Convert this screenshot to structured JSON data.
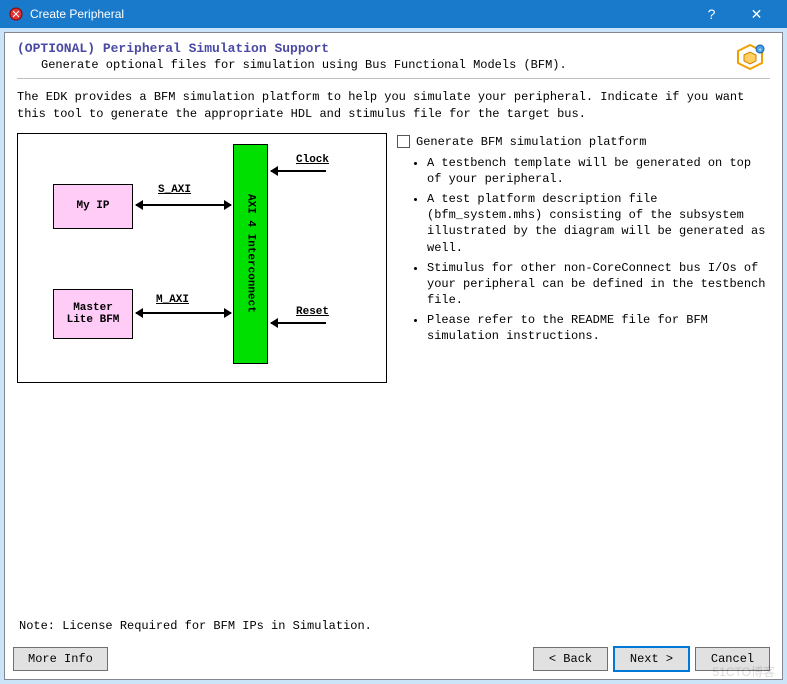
{
  "window": {
    "title": "Create Peripheral",
    "help_icon": "?",
    "close_icon": "✕"
  },
  "header": {
    "title": "(OPTIONAL) Peripheral Simulation Support",
    "description": "Generate optional files for simulation using Bus Functional Models (BFM)."
  },
  "intro": "The EDK provides a BFM simulation platform to help you simulate your peripheral. Indicate if you want this tool to generate the appropriate HDL and stimulus file for the target bus.",
  "diagram": {
    "my_ip": "My IP",
    "bfm": "Master Lite BFM",
    "interconnect": "AXI 4 Interconnect",
    "s_axi": "S_AXI",
    "m_axi": "M_AXI",
    "clock": "Clock",
    "reset": "Reset"
  },
  "checkbox": {
    "label": "Generate BFM simulation platform",
    "checked": false
  },
  "bullets": [
    "A testbench template will be generated on top of your peripheral.",
    "A test platform description file (bfm_system.mhs) consisting of the subsystem illustrated by the diagram will be generated as well.",
    "Stimulus for other non-CoreConnect bus I/Os of your peripheral can be defined in the testbench file.",
    "Please refer to the README file for BFM simulation instructions."
  ],
  "note": "Note: License Required for BFM IPs in Simulation.",
  "buttons": {
    "more_info": "More Info",
    "back": "< Back",
    "next": "Next >",
    "cancel": "Cancel"
  },
  "watermark": "51CTO博客"
}
